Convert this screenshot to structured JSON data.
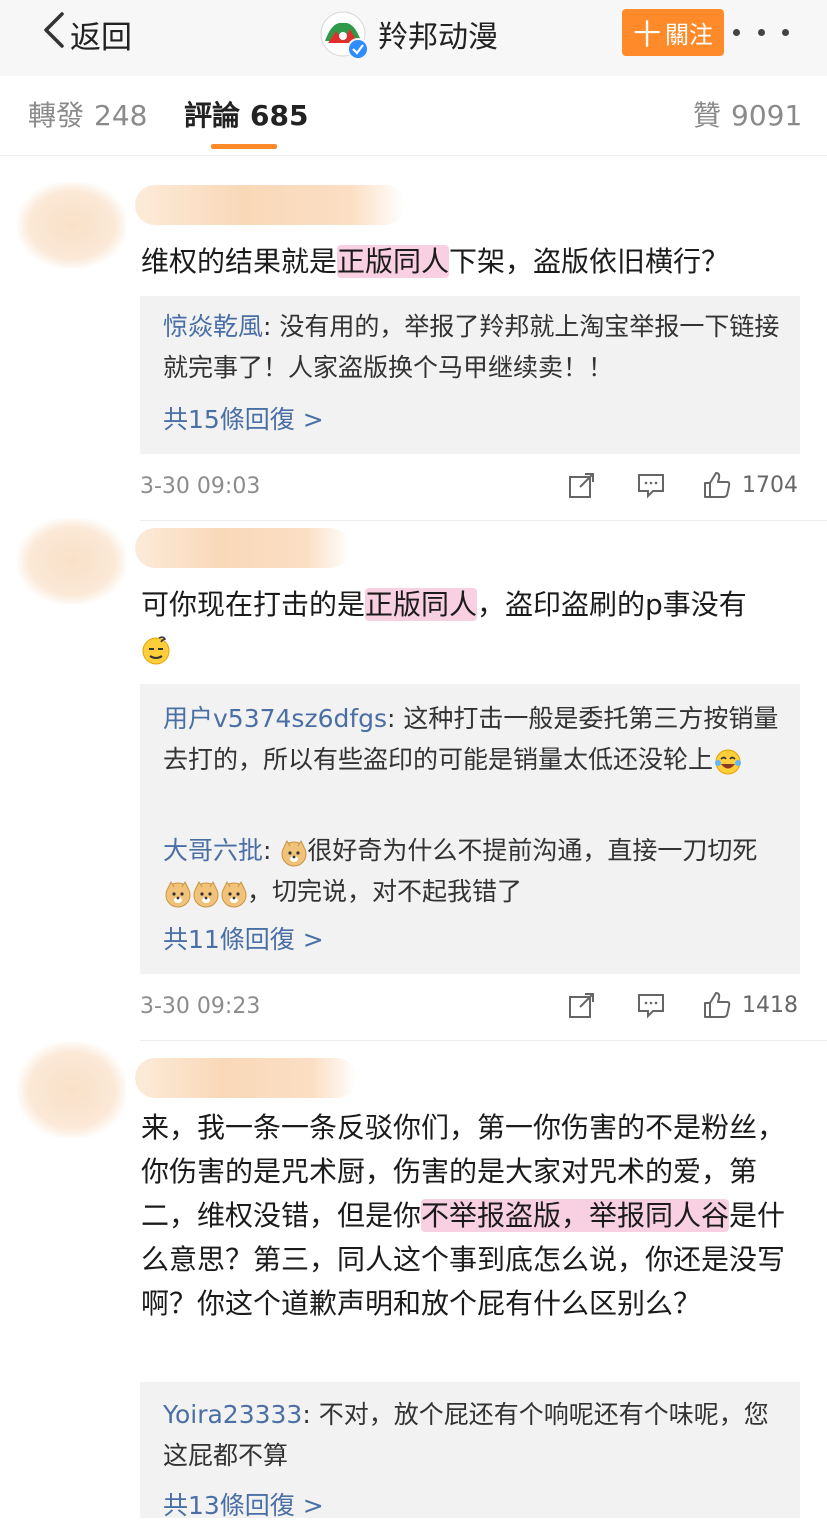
{
  "nav": {
    "back_label": "返回",
    "account_name": "羚邦动漫",
    "follow_label": "關注",
    "follow_prefix": "十"
  },
  "tabs": [
    {
      "label": "轉發",
      "count": "248"
    },
    {
      "label": "評論",
      "count": "685"
    },
    {
      "label": "贊",
      "count": "9091"
    }
  ],
  "colors": {
    "accent": "#ff8a2a",
    "link": "#4a6fa5",
    "highlight": "#f2aac8",
    "verified": "#2f8cff"
  },
  "comments": [
    {
      "text_a": "维权的结果就是",
      "text_hl": "正版同人",
      "text_b": "下架，盗版依旧横行？",
      "replies": [
        {
          "name": "惊焱乾風",
          "sep": ": ",
          "text": "没有用的，举报了羚邦就上淘宝举报一下链接就完事了！人家盗版换个马甲继续卖！！"
        }
      ],
      "more_replies": "共15條回復 >",
      "time": "3-30 09:03",
      "likes": "1704"
    },
    {
      "text_a": "可你现在打击的是",
      "text_hl": "正版同人",
      "text_b": "，盗印盗刷的p事没有",
      "replies": [
        {
          "name": "用户v5374sz6dfgs",
          "sep": ": ",
          "text_a": "这种打击一般是委托第三方按销量去打的，所以有些盗印的可能是销量太低还没轮上"
        },
        {
          "name": "大哥六批",
          "sep": ": ",
          "text_a": "很好奇为什么不提前沟通，直接一刀切死",
          "text_b": "，切完说，对不起我错了"
        }
      ],
      "more_replies": "共11條回復 >",
      "time": "3-30 09:23",
      "likes": "1418"
    },
    {
      "text_a": "来，我一条一条反驳你们，第一你伤害的不是粉丝，你伤害的是咒术厨，伤害的是大家对咒术的爱，第二，维权没错，但是你",
      "text_hl": "不举报盗版，举报同人谷",
      "text_b": "是什么意思？第三，同人这个事到底怎么说，你还是没写啊？你这个道歉声明和放个屁有什么区别么？",
      "replies": [
        {
          "name": "Yoira23333",
          "sep": ": ",
          "text": "不对，放个屁还有个响呢还有个味呢，您这屁都不算"
        }
      ],
      "more_replies": "共13條回復 >"
    }
  ]
}
